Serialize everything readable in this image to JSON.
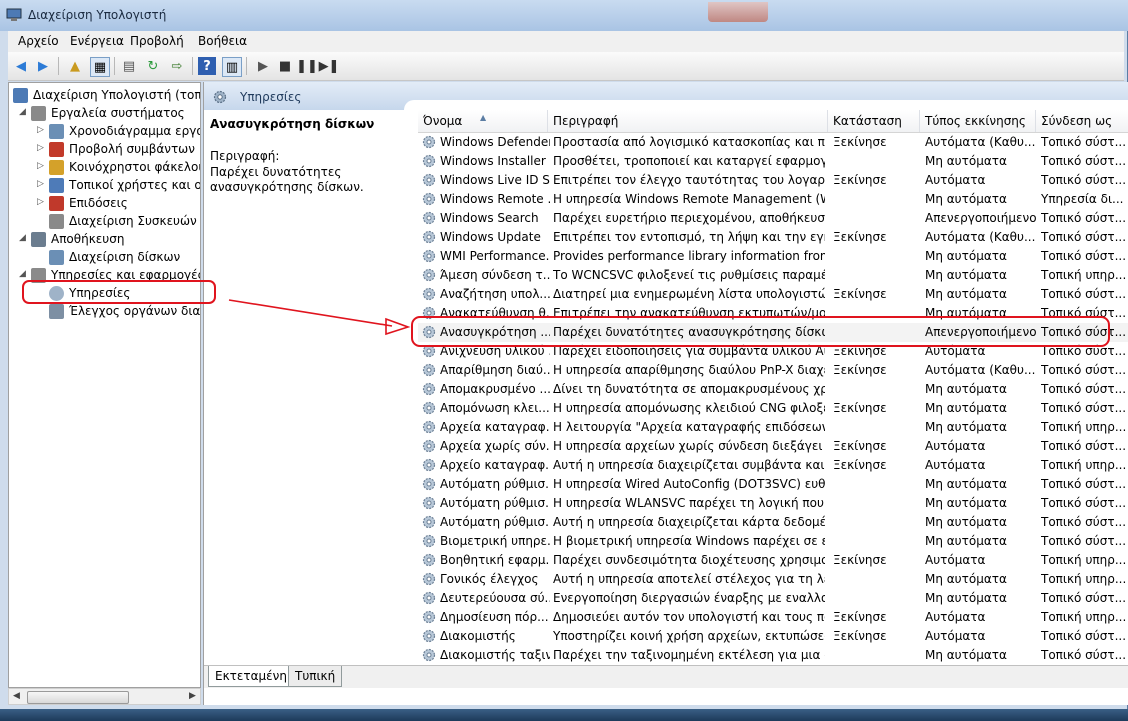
{
  "window": {
    "title": "Διαχείριση Υπολογιστή"
  },
  "menu": [
    "Αρχείο",
    "Ενέργεια",
    "Προβολή",
    "Βοήθεια"
  ],
  "tree": {
    "items": [
      {
        "label": "Διαχείριση Υπολογιστή (τοπικό)",
        "level": 0
      },
      {
        "label": "Εργαλεία συστήματος",
        "level": 1
      },
      {
        "label": "Χρονοδιάγραμμα εργασιών",
        "level": 2
      },
      {
        "label": "Προβολή συμβάντων",
        "level": 2
      },
      {
        "label": "Κοινόχρηστοι φάκελοι",
        "level": 2
      },
      {
        "label": "Τοπικοί χρήστες και ομάδες",
        "level": 2
      },
      {
        "label": "Επιδόσεις",
        "level": 2
      },
      {
        "label": "Διαχείριση Συσκευών",
        "level": 2
      },
      {
        "label": "Αποθήκευση",
        "level": 1
      },
      {
        "label": "Διαχείριση δίσκων",
        "level": 2
      },
      {
        "label": "Υπηρεσίες και εφαρμογές",
        "level": 1
      },
      {
        "label": "Υπηρεσίες",
        "level": 2
      },
      {
        "label": "Έλεγχος οργάνων διαχείρισης WMI",
        "level": 2
      }
    ]
  },
  "services_header": {
    "title": "Υπηρεσίες"
  },
  "detail": {
    "title": "Ανασυγκρότηση δίσκων",
    "label": "Περιγραφή:",
    "description": "Παρέχει δυνατότητες ανασυγκρότησης δίσκων."
  },
  "columns": [
    "Όνομα",
    "Περιγραφή",
    "Κατάσταση",
    "Τύπος εκκίνησης",
    "Σύνδεση ως"
  ],
  "rows": [
    [
      "Windows Defender",
      "Προστασία από λογισμικό κατασκοπίας και πιθ...",
      "Ξεκίνησε",
      "Αυτόματα (Καθυ...",
      "Τοπικό σύστ..."
    ],
    [
      "Windows Installer",
      "Προσθέτει, τροποποιεί και καταργεί εφαρμογές ...",
      "",
      "Μη αυτόματα",
      "Τοπικό σύστ..."
    ],
    [
      "Windows Live ID S...",
      "Επιτρέπει τον έλεγχο ταυτότητας του λογαριασ...",
      "Ξεκίνησε",
      "Αυτόματα",
      "Τοπικό σύστ..."
    ],
    [
      "Windows Remote ...",
      "Η υπηρεσία Windows Remote Management (Wi...",
      "",
      "Μη αυτόματα",
      "Υπηρεσία δι..."
    ],
    [
      "Windows Search",
      "Παρέχει ευρετήριο περιεχομένου, αποθήκευση ...",
      "",
      "Απενεργοποιήμενο",
      "Τοπικό σύστ..."
    ],
    [
      "Windows Update",
      "Επιτρέπει τον εντοπισμό, τη λήψη και την εγκατ...",
      "Ξεκίνησε",
      "Αυτόματα (Καθυ...",
      "Τοπικό σύστ..."
    ],
    [
      "WMI Performance...",
      "Provides performance library information from ...",
      "",
      "Μη αυτόματα",
      "Τοπικό σύστ..."
    ],
    [
      "Άμεση σύνδεση τ...",
      "Το WCNCSVC φιλοξενεί τις ρυθμίσεις παραμέτρ...",
      "",
      "Μη αυτόματα",
      "Τοπική υπηρ..."
    ],
    [
      "Αναζήτηση υπολ...",
      "Διατηρεί μια ενημερωμένη λίστα υπολογιστών ...",
      "Ξεκίνησε",
      "Μη αυτόματα",
      "Τοπικό σύστ..."
    ],
    [
      "Ανακατεύθυνση θ...",
      "Επιτρέπει την ανακατεύθυνση εκτυπωτών/μον...",
      "",
      "Μη αυτόματα",
      "Τοπικό σύστ..."
    ],
    [
      "Ανασυγκρότηση ...",
      "Παρέχει δυνατότητες ανασυγκρότησης δίσκων.",
      "",
      "Απενεργοποιήμενο",
      "Τοπικό σύστ..."
    ],
    [
      "Ανίχνευση υλικού ...",
      "Παρέχει ειδοποιήσεις για συμβάντα υλικού Auto...",
      "Ξεκίνησε",
      "Αυτόματα",
      "Τοπικό σύστ..."
    ],
    [
      "Απαρίθμηση διαύ...",
      "Η υπηρεσία απαρίθμησης διαύλου PnP-X διαχει...",
      "Ξεκίνησε",
      "Αυτόματα (Καθυ...",
      "Τοπικό σύστ..."
    ],
    [
      "Απομακρυσμένο ...",
      "Δίνει τη δυνατότητα σε απομακρυσμένους χρήσ...",
      "",
      "Μη αυτόματα",
      "Τοπικό σύστ..."
    ],
    [
      "Απομόνωση κλει...",
      "Η υπηρεσία απομόνωσης κλειδιού CNG φιλοξεν...",
      "Ξεκίνησε",
      "Μη αυτόματα",
      "Τοπικό σύστ..."
    ],
    [
      "Αρχεία καταγραφ...",
      "Η λειτουργία \"Αρχεία καταγραφής επιδόσεων κ...",
      "",
      "Μη αυτόματα",
      "Τοπική υπηρ..."
    ],
    [
      "Αρχεία χωρίς σύν...",
      "Η υπηρεσία αρχείων χωρίς σύνδεση διεξάγει δρ...",
      "Ξεκίνησε",
      "Αυτόματα",
      "Τοπικό σύστ..."
    ],
    [
      "Αρχείο καταγραφ...",
      "Αυτή η υπηρεσία διαχειρίζεται συμβάντα και αρ...",
      "Ξεκίνησε",
      "Αυτόματα",
      "Τοπική υπηρ..."
    ],
    [
      "Αυτόματη ρύθμισ...",
      "Η υπηρεσία Wired AutoConfig (DOT3SVC) ευθύν...",
      "",
      "Μη αυτόματα",
      "Τοπικό σύστ..."
    ],
    [
      "Αυτόματη ρύθμισ...",
      "Η υπηρεσία WLANSVC παρέχει τη λογική που α...",
      "",
      "Μη αυτόματα",
      "Τοπικό σύστ..."
    ],
    [
      "Αυτόματη ρύθμισ...",
      "Αυτή η υπηρεσία διαχειρίζεται κάρτα δεδομένω...",
      "",
      "Μη αυτόματα",
      "Τοπικό σύστ..."
    ],
    [
      "Βιομετρική υπηρε...",
      "Η βιομετρική υπηρεσία Windows παρέχει σε εφα...",
      "",
      "Μη αυτόματα",
      "Τοπικό σύστ..."
    ],
    [
      "Βοηθητική εφαρμ...",
      "Παρέχει συνδεσιμότητα διοχέτευσης χρησιμοπο...",
      "Ξεκίνησε",
      "Αυτόματα",
      "Τοπική υπηρ..."
    ],
    [
      "Γονικός έλεγχος",
      "Αυτή η υπηρεσία αποτελεί στέλεχος για τη λειτο...",
      "",
      "Μη αυτόματα",
      "Τοπική υπηρ..."
    ],
    [
      "Δευτερεύουσα σύ...",
      "Ενεργοποίηση διεργασιών έναρξης με εναλλακτι...",
      "",
      "Μη αυτόματα",
      "Τοπικό σύστ..."
    ],
    [
      "Δημοσίευση πόρ...",
      "Δημοσιεύει αυτόν τον υπολογιστή και τους πόρ...",
      "Ξεκίνησε",
      "Αυτόματα",
      "Τοπική υπηρ..."
    ],
    [
      "Διακομιστής",
      "Υποστηρίζει κοινή χρήση αρχείων, εκτυπώσεω...",
      "Ξεκίνησε",
      "Αυτόματα",
      "Τοπικό σύστ..."
    ],
    [
      "Διακομιστής ταξιν...",
      "Παρέχει την ταξινομημένη εκτέλεση για μια ομά...",
      "",
      "Μη αυτόματα",
      "Τοπικό σύστ..."
    ]
  ],
  "tabs": [
    "Εκτεταμένη",
    "Τυπική"
  ],
  "colors": {
    "annotation": "#e0141e",
    "header": "#c6d7ec"
  }
}
